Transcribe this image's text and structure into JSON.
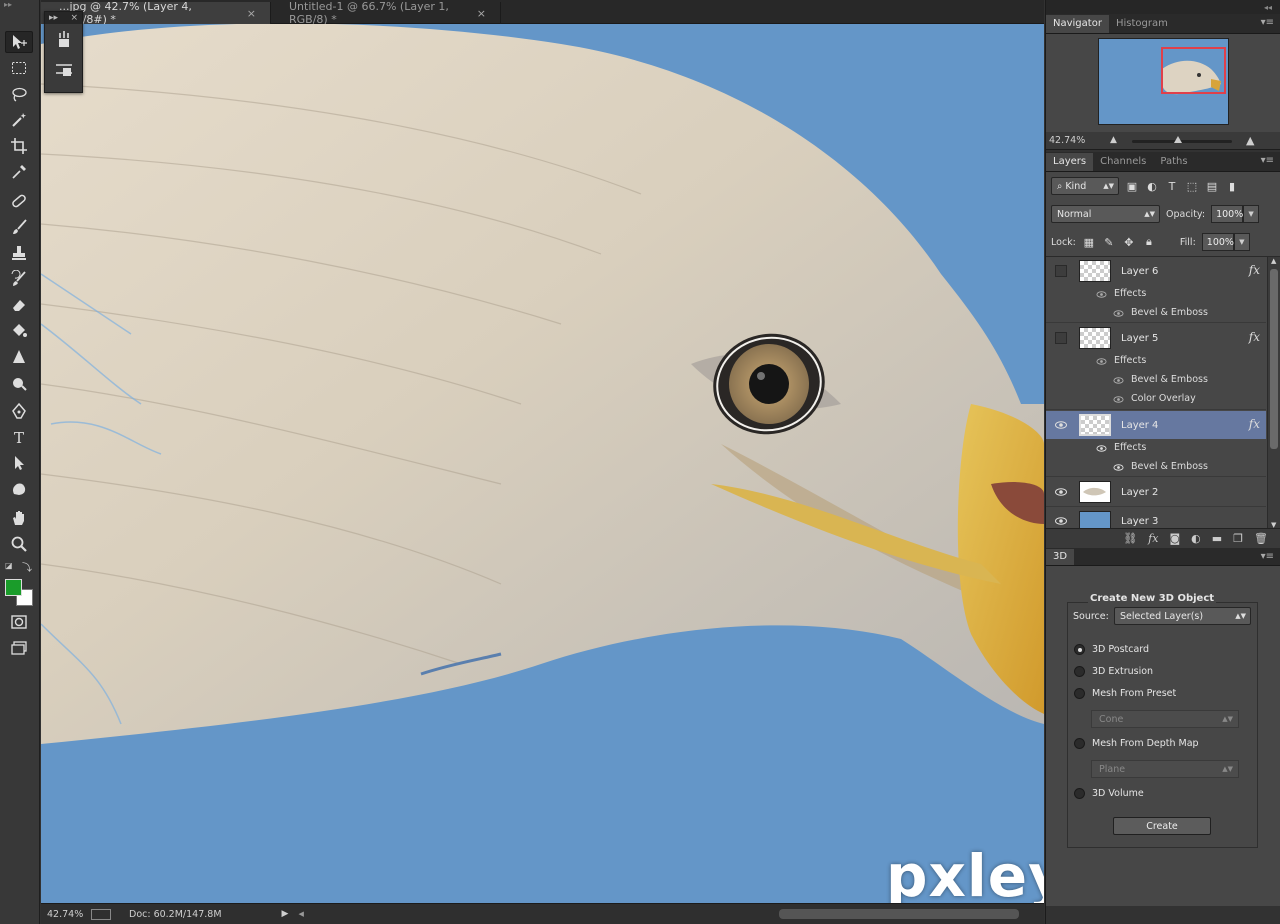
{
  "tabs": [
    {
      "label": "...jpg @ 42.7% (Layer 4, RGB/8#) *",
      "close": "×"
    },
    {
      "label": "Untitled-1 @ 66.7% (Layer 1, RGB/8) *",
      "close": "×"
    }
  ],
  "status": {
    "zoom": "42.74%",
    "doc": "Doc: 60.2M/147.8M"
  },
  "watermark": "pxleyes.com",
  "colors": {
    "foreground": "#1a9c2a",
    "background": "#ffffff",
    "canvas_bg": "#6496c8",
    "selected_layer": "#6678a0"
  },
  "navigator": {
    "tabs": [
      "Navigator",
      "Histogram"
    ],
    "zoom": "42.74%"
  },
  "layers_panel": {
    "tabs": [
      "Layers",
      "Channels",
      "Paths"
    ],
    "filter_kind": "Kind",
    "blend_mode": "Normal",
    "opacity_label": "Opacity:",
    "opacity_value": "100%",
    "lock_label": "Lock:",
    "fill_label": "Fill:",
    "fill_value": "100%",
    "layers": [
      {
        "name": "Layer 6",
        "visible": false,
        "fx": "fx",
        "effects_label": "Effects",
        "effects": [
          "Bevel & Emboss"
        ]
      },
      {
        "name": "Layer 5",
        "visible": false,
        "fx": "fx",
        "effects_label": "Effects",
        "effects": [
          "Bevel & Emboss",
          "Color Overlay"
        ]
      },
      {
        "name": "Layer 4",
        "visible": true,
        "selected": true,
        "fx": "fx",
        "effects_label": "Effects",
        "effects": [
          "Bevel & Emboss"
        ]
      },
      {
        "name": "Layer 2",
        "visible": true
      },
      {
        "name": "Layer 3",
        "visible": true
      }
    ]
  },
  "panel3d": {
    "tab": "3D",
    "title": "Create New 3D Object",
    "source_label": "Source:",
    "source_value": "Selected Layer(s)",
    "options": [
      "3D Postcard",
      "3D Extrusion",
      "Mesh From Preset",
      "Mesh From Depth Map",
      "3D Volume"
    ],
    "selected_option": "3D Postcard",
    "preset_value": "Cone",
    "depth_value": "Plane",
    "create_button": "Create"
  },
  "icons": [
    "move-icon",
    "marquee-icon",
    "lasso-icon",
    "quick-select-icon",
    "crop-icon",
    "eyedropper-icon",
    "healing-icon",
    "brush-icon",
    "stamp-icon",
    "history-brush-icon",
    "eraser-icon",
    "bucket-icon",
    "blur-icon",
    "dodge-icon",
    "pen-icon",
    "type-icon",
    "path-select-icon",
    "shape-icon",
    "hand-icon",
    "zoom-icon",
    "quickmask-icon",
    "screen-mode-icon"
  ]
}
